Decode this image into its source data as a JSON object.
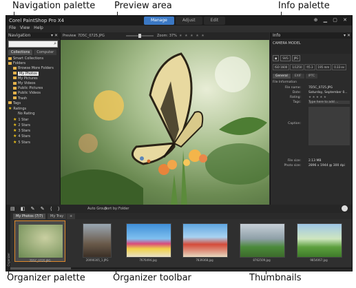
{
  "callouts": {
    "navigation_palette": "Navigation palette",
    "preview_area": "Preview area",
    "info_palette": "Info palette",
    "organizer_palette": "Organizer palette",
    "organizer_toolbar": "Organizer toolbar",
    "thumbnails": "Thumbnails"
  },
  "app": {
    "title": "Corel PaintShop Pro X4",
    "tabs": [
      "Manage",
      "Adjust",
      "Edit"
    ],
    "active_tab": "Manage",
    "window_controls": "⊕ ▁ ▢ ✕"
  },
  "menu": {
    "items": [
      "File",
      "View",
      "Help"
    ]
  },
  "navigation": {
    "header": "Navigation",
    "subtabs": [
      "Collections",
      "Computer"
    ],
    "items": [
      {
        "label": "Smart Collections",
        "indent": 0,
        "icon": "folder"
      },
      {
        "label": "Folders",
        "indent": 0,
        "icon": "folder"
      },
      {
        "label": "Browse More Folders",
        "indent": 1,
        "icon": "folder"
      },
      {
        "label": "My Photos",
        "indent": 1,
        "icon": "folder",
        "selected": true
      },
      {
        "label": "My Pictures",
        "indent": 1,
        "icon": "folder"
      },
      {
        "label": "My Videos",
        "indent": 1,
        "icon": "folder"
      },
      {
        "label": "Public Pictures",
        "indent": 1,
        "icon": "folder"
      },
      {
        "label": "Public Videos",
        "indent": 1,
        "icon": "folder"
      },
      {
        "label": "Trash",
        "indent": 1,
        "icon": "folder"
      },
      {
        "label": "Tags",
        "indent": 0,
        "icon": "folder"
      },
      {
        "label": "Ratings",
        "indent": 0,
        "icon": "star"
      },
      {
        "label": "No Rating",
        "indent": 1,
        "icon": "none"
      },
      {
        "label": "1 Star",
        "indent": 1,
        "icon": "star"
      },
      {
        "label": "2 Stars",
        "indent": 1,
        "icon": "star"
      },
      {
        "label": "3 Stars",
        "indent": 1,
        "icon": "star"
      },
      {
        "label": "4 Stars",
        "indent": 1,
        "icon": "star"
      },
      {
        "label": "5 Stars",
        "indent": 1,
        "icon": "star"
      }
    ]
  },
  "preview": {
    "label": "Preview",
    "filename": "7D5C_0725.JPG",
    "zoom_label": "Zoom:",
    "zoom_value": "37%",
    "stars": "★ ★ ★ ★ ★"
  },
  "info": {
    "header": "Info",
    "camera_model": "CAMERA MODEL",
    "formats": [
      "◼",
      "SVG",
      "JPG"
    ],
    "exif": [
      "ISO 1600",
      "1/1250",
      "f/5.3",
      "195 mm",
      "0.33 ev"
    ],
    "tabs": [
      "General",
      "EXIF",
      "IPTC"
    ],
    "section": "File Information",
    "fields": [
      {
        "k": "File name:",
        "v": "7D5C_0725.JPG"
      },
      {
        "k": "Date:",
        "v": "Saturday, September 0..."
      },
      {
        "k": "Rating:",
        "v": "★ ★ ★ ★ ★"
      }
    ],
    "tags_label": "Tags:",
    "tags_placeholder": "Type here to add ...",
    "caption_label": "Caption:",
    "bottom_fields": [
      {
        "k": "File size:",
        "v": "2.13 MB"
      },
      {
        "k": "Photo size:",
        "v": "2896 x 1944 @ 300 dpi"
      }
    ]
  },
  "organizer": {
    "toolbar_icons": "▤ ◧ ✎ ✎ ⟨ ⟩",
    "auto_group": "Auto Group",
    "sort_by": "Sort by:",
    "sort_value": "Folder",
    "tabs": [
      "My Photos (7/7)",
      "My Tray",
      "+"
    ],
    "side_label": "Organizer",
    "thumbnails": [
      {
        "caption": "7D5C_0725.JPG",
        "active": true
      },
      {
        "caption": "20090305_1.JPG"
      },
      {
        "caption": "7676494.jpg"
      },
      {
        "caption": "7839368.jpg"
      },
      {
        "caption": "8762509.jpg"
      },
      {
        "caption": "9854067.jpg"
      }
    ]
  }
}
